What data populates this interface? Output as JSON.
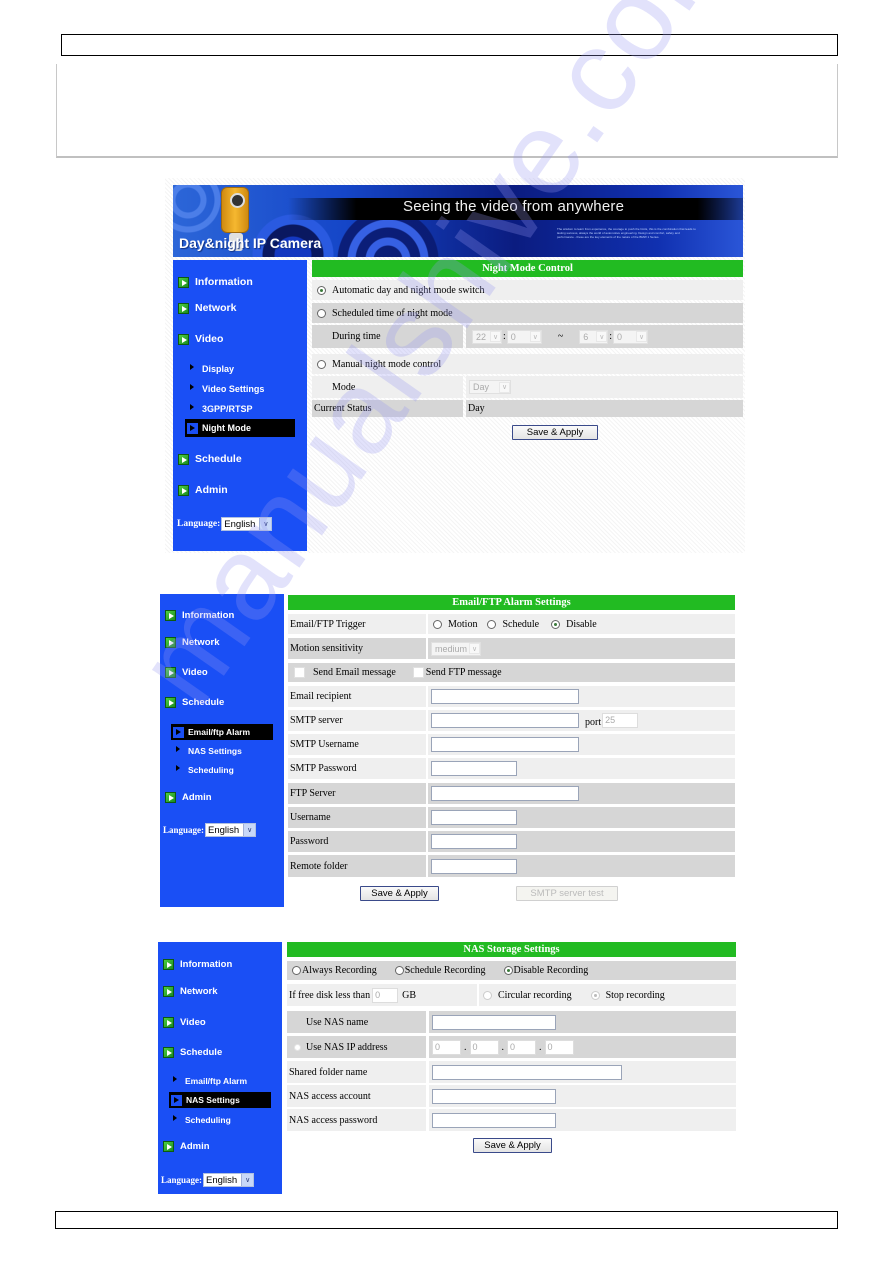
{
  "watermark": "manualshive.com",
  "banner": {
    "tagline": "Seeing the video from anywhere",
    "product": "Day&night IP Camera",
    "small_text": "The wisdom to learn from experience, the courage to push the limits, this is the combination that leads to lasting success, always the world of automotive engineering. Design and comfort, safety and performance - these are the key elements of the nature of the BMW 1 Series."
  },
  "nav": {
    "main": [
      "Information",
      "Network",
      "Video",
      "Schedule",
      "Admin"
    ],
    "video_sub": [
      "Display",
      "Video Settings",
      "3GPP/RTSP",
      "Night Mode"
    ],
    "schedule_sub": [
      "Email/ftp Alarm",
      "NAS Settings",
      "Scheduling"
    ],
    "language_label": "Language:",
    "language_value": "English",
    "dropdown_arrow": "∨"
  },
  "night_mode": {
    "title": "Night Mode Control",
    "auto_label": "Automatic day and night mode switch",
    "auto_selected": true,
    "scheduled_label": "Scheduled time of night mode",
    "during_time_label": "During time",
    "start_hour": "22",
    "start_minute": "0",
    "separator_colon": ":",
    "separator_tilde": "~",
    "end_hour": "6",
    "end_minute": "0",
    "manual_label": "Manual night mode control",
    "mode_label": "Mode",
    "mode_value": "Day",
    "status_label": "Current Status",
    "status_value": "Day",
    "save_button": "Save & Apply"
  },
  "email_ftp": {
    "title": "Email/FTP Alarm Settings",
    "trigger_label": "Email/FTP Trigger",
    "trigger_options": [
      "Motion",
      "Schedule",
      "Disable"
    ],
    "trigger_selected": "Disable",
    "sensitivity_label": "Motion sensitivity",
    "sensitivity_value": "medium",
    "send_email_label": "Send Email message",
    "send_ftp_label": "Send FTP message",
    "email_recipient_label": "Email recipient",
    "smtp_server_label": "SMTP server",
    "port_label": "port",
    "port_value": "25",
    "smtp_username_label": "SMTP Username",
    "smtp_password_label": "SMTP Password",
    "ftp_server_label": "FTP Server",
    "username_label": "Username",
    "password_label": "Password",
    "remote_folder_label": "Remote folder",
    "save_button": "Save & Apply",
    "smtp_test_button": "SMTP server test"
  },
  "nas": {
    "title": "NAS Storage Settings",
    "recording_options": [
      "Always Recording",
      "Schedule Recording",
      "Disable Recording"
    ],
    "recording_selected": "Disable Recording",
    "free_disk_label": "If free disk less than",
    "free_disk_value": "0",
    "free_disk_unit": "GB",
    "circular_label": "Circular recording",
    "stop_label": "Stop recording",
    "use_name_label": "Use NAS name",
    "use_ip_label": "Use NAS IP address",
    "ip_octets": [
      "0",
      "0",
      "0",
      "0"
    ],
    "ip_dot": ".",
    "shared_folder_label": "Shared folder name",
    "account_label": "NAS access account",
    "password_label": "NAS access password",
    "save_button": "Save & Apply"
  }
}
